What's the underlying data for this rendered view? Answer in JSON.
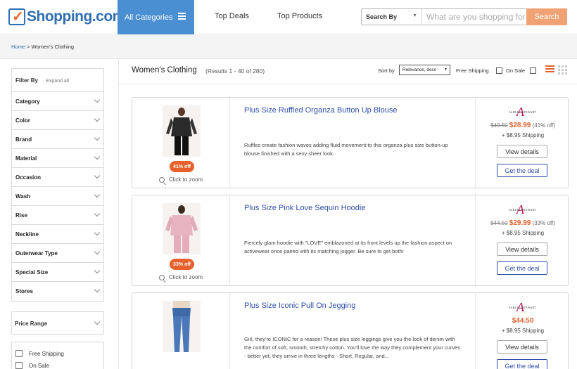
{
  "header": {
    "logo_text": "Shopping.com",
    "logo_reg": "®",
    "all_categories": "All Categories",
    "top_deals": "Top Deals",
    "top_products": "Top Products",
    "search_by": "Search By",
    "search_placeholder": "What are you shopping for?",
    "search_button": "Search"
  },
  "breadcrumb": {
    "home": "Home",
    "sep": ">",
    "current": "Women's Clothing"
  },
  "sidebar": {
    "filter_by": "Filter By",
    "expand_all": "Expand all",
    "filters": [
      "Category",
      "Color",
      "Brand",
      "Material",
      "Occasion",
      "Wash",
      "Rise",
      "Neckline",
      "Outerwear Type",
      "Special Size",
      "Stores"
    ],
    "price_range": "Price Range",
    "free_shipping": "Free Shipping",
    "on_sale": "On Sale"
  },
  "main": {
    "title": "Women's Clothing",
    "results": "(Results 1 - 40 of 280)",
    "sort_by_label": "Sort by",
    "sort_value": "Relevance, desc",
    "free_shipping": "Free Shipping",
    "on_sale": "On Sale"
  },
  "colors": {
    "accent_orange": "#e8612c",
    "brand_blue": "#2f6fb2",
    "category_blue": "#4a8fd1",
    "title_blue": "#2f4fa8"
  },
  "products": [
    {
      "title": "Plus Size Ruffled Organza Button Up Blouse",
      "description": "Ruffles create fashion waves adding fluid movement to this organza plus size button-up blouse finished with a sexy sheer look.",
      "badge": "41% off",
      "zoom": "Click to zoom",
      "brand_mark": "A",
      "brand_name": "ASHLEY STEWART",
      "old_price": "$49.50",
      "new_price": "$28.99",
      "discount": "(41% off)",
      "shipping": "+ $8.95 Shipping",
      "view_details": "View details",
      "get_deal": "Get the deal"
    },
    {
      "title": "Plus Size Pink Love Sequin Hoodie",
      "description": "Fiercely glam hoodie with \"LOVE\" emblazoned at its front levels up the fashion aspect on activewear once paired with its matching jogger. Be sure to get both!",
      "badge": "33% off",
      "zoom": "Click to zoom",
      "brand_mark": "A",
      "brand_name": "ASHLEY STEWART",
      "old_price": "$44.50",
      "new_price": "$29.99",
      "discount": "(33% off)",
      "shipping": "+ $8.95 Shipping",
      "view_details": "View details",
      "get_deal": "Get the deal"
    },
    {
      "title": "Plus Size Iconic Pull On Jegging",
      "description": "Girl, they're ICONIC for a reason! These plus size leggings give you the look of denim with the comfort of soft, smooth, stretchy cotton. You'll love the way they complement your curves - better yet, they arrive in three lengths - Short, Regular, and...",
      "brand_mark": "A",
      "brand_name": "ASHLEY STEWART",
      "new_price": "$44.50",
      "shipping": "+ $8.95 Shipping",
      "view_details": "View details",
      "get_deal": "Get the deal"
    }
  ]
}
